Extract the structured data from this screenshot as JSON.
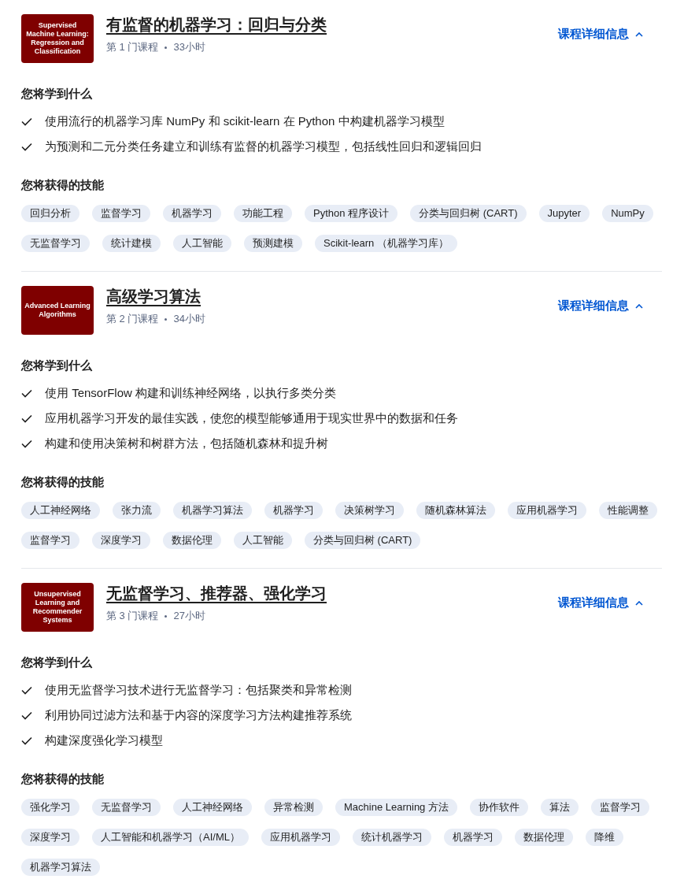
{
  "courses": [
    {
      "thumb_text": "Supervised Machine Learning: Regression and Classification",
      "title": "有监督的机器学习：回归与分类",
      "order": "第 1 门课程",
      "hours": "33小时",
      "details_link": "课程详细信息",
      "expanded": true,
      "learn_heading": "您将学到什么",
      "learn_items": [
        "使用流行的机器学习库 NumPy 和 scikit-learn 在 Python 中构建机器学习模型",
        "为预测和二元分类任务建立和训练有监督的机器学习模型，包括线性回归和逻辑回归"
      ],
      "skills_heading": "您将获得的技能",
      "skills": [
        "回归分析",
        "监督学习",
        "机器学习",
        "功能工程",
        "Python 程序设计",
        "分类与回归树 (CART)",
        "Jupyter",
        "NumPy",
        "无监督学习",
        "统计建模",
        "人工智能",
        "预测建模",
        "Scikit-learn （机器学习库）"
      ]
    },
    {
      "thumb_text": "Advanced Learning Algorithms",
      "title": "高级学习算法",
      "order": "第 2 门课程",
      "hours": "34小时",
      "details_link": "课程详细信息",
      "expanded": true,
      "learn_heading": "您将学到什么",
      "learn_items": [
        "使用 TensorFlow 构建和训练神经网络，以执行多类分类",
        "应用机器学习开发的最佳实践，使您的模型能够通用于现实世界中的数据和任务",
        "构建和使用决策树和树群方法，包括随机森林和提升树"
      ],
      "skills_heading": "您将获得的技能",
      "skills": [
        "人工神经网络",
        "张力流",
        "机器学习算法",
        "机器学习",
        "决策树学习",
        "随机森林算法",
        "应用机器学习",
        "性能调整",
        "监督学习",
        "深度学习",
        "数据伦理",
        "人工智能",
        "分类与回归树 (CART)"
      ]
    },
    {
      "thumb_text": "Unsupervised Learning and Recommender Systems",
      "title": "无监督学习、推荐器、强化学习",
      "order": "第 3 门课程",
      "hours": "27小时",
      "details_link": "课程详细信息",
      "expanded": true,
      "learn_heading": "您将学到什么",
      "learn_items": [
        "使用无监督学习技术进行无监督学习：包括聚类和异常检测",
        "利用协同过滤方法和基于内容的深度学习方法构建推荐系统",
        "构建深度强化学习模型"
      ],
      "skills_heading": "您将获得的技能",
      "skills": [
        "强化学习",
        "无监督学习",
        "人工神经网络",
        "异常检测",
        "Machine Learning 方法",
        "协作软件",
        "算法",
        "监督学习",
        "深度学习",
        "人工智能和机器学习（AI/ML）",
        "应用机器学习",
        "统计机器学习",
        "机器学习",
        "数据伦理",
        "降维",
        "机器学习算法"
      ]
    }
  ]
}
